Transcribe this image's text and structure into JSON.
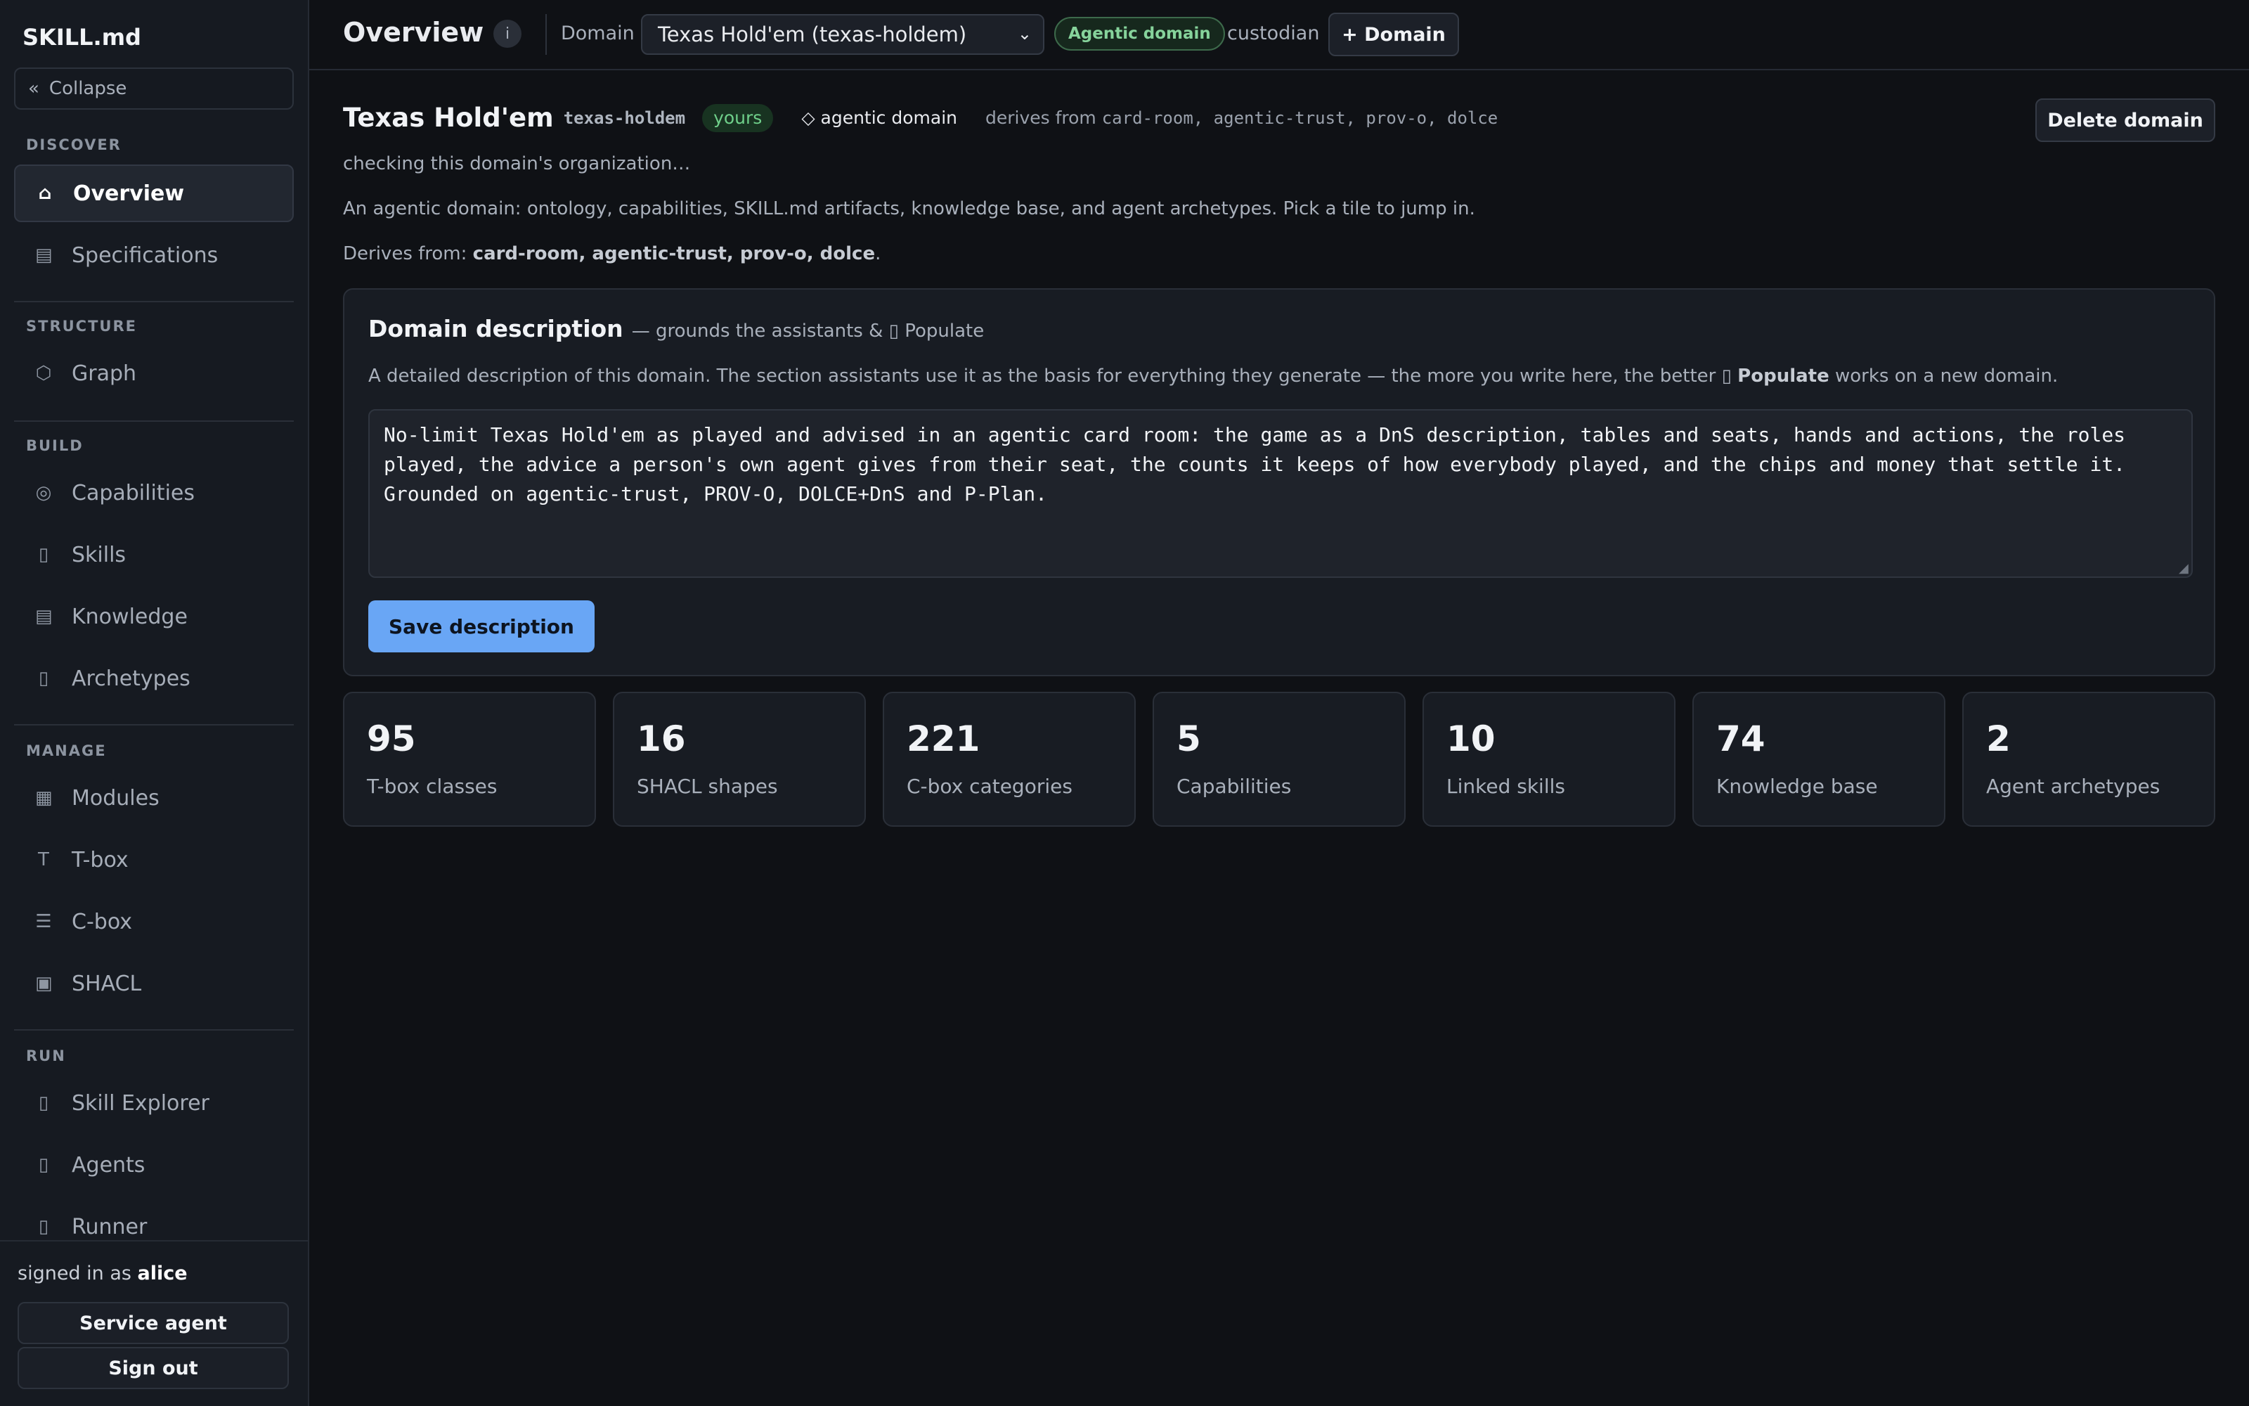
{
  "sidebar": {
    "brand": "SKILL.md",
    "collapse": {
      "icon": "«",
      "label": "Collapse"
    },
    "sections": {
      "discover": "DISCOVER",
      "structure": "STRUCTURE",
      "build": "BUILD",
      "manage": "MANAGE",
      "run": "RUN"
    },
    "items": {
      "overview": {
        "icon": "⌂",
        "label": "Overview"
      },
      "specifications": {
        "icon": "▤",
        "label": "Specifications"
      },
      "graph": {
        "icon": "⬡",
        "label": "Graph"
      },
      "capabilities": {
        "icon": "◎",
        "label": "Capabilities"
      },
      "skills": {
        "icon": "▯",
        "label": "Skills"
      },
      "knowledge": {
        "icon": "▤",
        "label": "Knowledge"
      },
      "archetypes": {
        "icon": "▯",
        "label": "Archetypes"
      },
      "modules": {
        "icon": "▦",
        "label": "Modules"
      },
      "tbox": {
        "icon": "T",
        "label": "T-box"
      },
      "cbox": {
        "icon": "☰",
        "label": "C-box"
      },
      "shacl": {
        "icon": "▣",
        "label": "SHACL"
      },
      "skill_explorer": {
        "icon": "▯",
        "label": "Skill Explorer"
      },
      "agents": {
        "icon": "▯",
        "label": "Agents"
      },
      "runner": {
        "icon": "▯",
        "label": "Runner"
      }
    },
    "footer": {
      "signed_prefix": "signed in as ",
      "user": "alice",
      "service_agent": "Service agent",
      "sign_out": "Sign out"
    }
  },
  "topbar": {
    "title": "Overview",
    "info": "i",
    "domain_label": "Domain",
    "domain_selected": "Texas Hold'em (texas-holdem)",
    "agentic_badge": "Agentic domain",
    "role": "custodian",
    "add_domain": "+ Domain"
  },
  "domain": {
    "name": "Texas Hold'em",
    "slug": "texas-holdem",
    "ownership": "yours",
    "kind": "◇ agentic domain",
    "derives_prefix": "derives from ",
    "derives_list": "card-room, agentic-trust, prov-o, dolce",
    "delete": "Delete domain",
    "org_status": "checking this domain's organization…",
    "summary": "An agentic domain: ontology, capabilities, SKILL.md artifacts, knowledge base, and agent archetypes. Pick a tile to jump in.",
    "derives_label": "Derives from: ",
    "derives_bold": "card-room, agentic-trust, prov-o, dolce",
    "derives_end": "."
  },
  "description": {
    "title": "Domain description",
    "subtitle": "— grounds the assistants & ▯ Populate",
    "help_pre": "A detailed description of this domain. The section assistants use it as the basis for everything they generate — the more you write here, the better ▯ ",
    "help_bold": "Populate",
    "help_post": " works on a new domain.",
    "text": "No-limit Texas Hold'em as played and advised in an agentic card room: the game as a DnS description, tables and seats, hands and actions, the roles\nplayed, the advice a person's own agent gives from their seat, the counts it keeps of how everybody played, and the chips and money that settle it.\nGrounded on agentic-trust, PROV-O, DOLCE+DnS and P-Plan.",
    "save": "Save description"
  },
  "stats": [
    {
      "value": "95",
      "label": "T-box classes"
    },
    {
      "value": "16",
      "label": "SHACL shapes"
    },
    {
      "value": "221",
      "label": "C-box categories"
    },
    {
      "value": "5",
      "label": "Capabilities"
    },
    {
      "value": "10",
      "label": "Linked skills"
    },
    {
      "value": "74",
      "label": "Knowledge base"
    },
    {
      "value": "2",
      "label": "Agent archetypes"
    }
  ],
  "colors": {
    "accent": "#69a6f5",
    "agentic_green": "#86d39b",
    "background": "#0f1115"
  }
}
